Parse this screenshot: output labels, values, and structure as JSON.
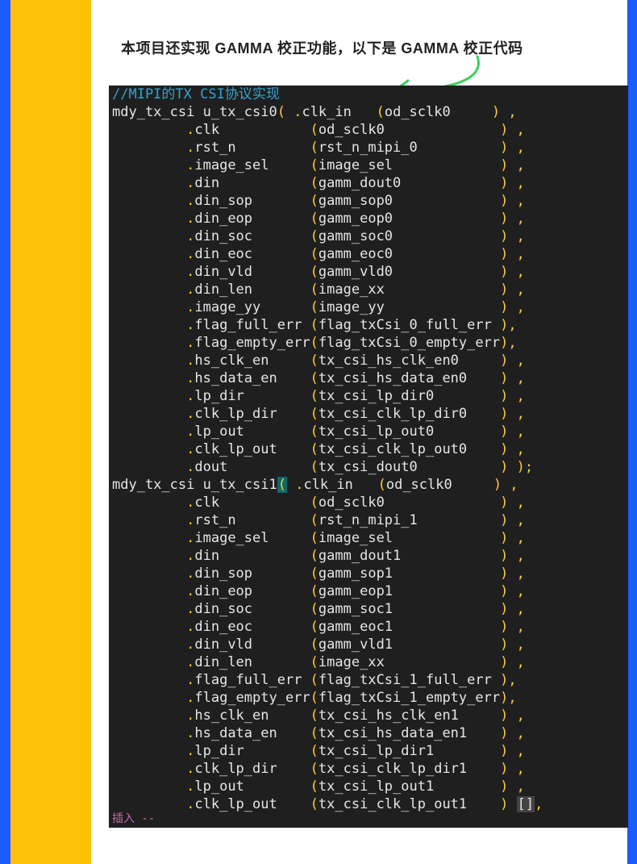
{
  "heading": "本项目还实现 GAMMA 校正功能，以下是 GAMMA 校正代码",
  "bottom_hint": "插入 --",
  "code": {
    "comment": "//MIPI的TX CSI协议实现",
    "inst0": {
      "module": "mdy_tx_csi",
      "name": "u_tx_csi0",
      "first_port": "clk_in",
      "first_sig": "od_sclk0",
      "ports": [
        {
          "p": "clk",
          "s": "od_sclk0"
        },
        {
          "p": "rst_n",
          "s": "rst_n_mipi_0"
        },
        {
          "p": "image_sel",
          "s": "image_sel"
        },
        {
          "p": "din",
          "s": "gamm_dout0"
        },
        {
          "p": "din_sop",
          "s": "gamm_sop0"
        },
        {
          "p": "din_eop",
          "s": "gamm_eop0"
        },
        {
          "p": "din_soc",
          "s": "gamm_soc0"
        },
        {
          "p": "din_eoc",
          "s": "gamm_eoc0"
        },
        {
          "p": "din_vld",
          "s": "gamm_vld0"
        },
        {
          "p": "din_len",
          "s": "image_xx"
        },
        {
          "p": "image_yy",
          "s": "image_yy"
        },
        {
          "p": "flag_full_err",
          "s": "flag_txCsi_0_full_err",
          "nosp": true
        },
        {
          "p": "flag_empty_err",
          "s": "flag_txCsi_0_empty_err",
          "nosp": true
        },
        {
          "p": "hs_clk_en",
          "s": "tx_csi_hs_clk_en0"
        },
        {
          "p": "hs_data_en",
          "s": "tx_csi_hs_data_en0"
        },
        {
          "p": "lp_dir",
          "s": "tx_csi_lp_dir0"
        },
        {
          "p": "clk_lp_dir",
          "s": "tx_csi_clk_lp_dir0"
        },
        {
          "p": "lp_out",
          "s": "tx_csi_lp_out0"
        },
        {
          "p": "clk_lp_out",
          "s": "tx_csi_clk_lp_out0"
        },
        {
          "p": "dout",
          "s": "tx_csi_dout0",
          "last": true
        }
      ]
    },
    "inst1": {
      "module": "mdy_tx_csi",
      "name": "u_tx_csi1",
      "first_port": "clk_in",
      "first_sig": "od_sclk0",
      "ports": [
        {
          "p": "clk",
          "s": "od_sclk0"
        },
        {
          "p": "rst_n",
          "s": "rst_n_mipi_1"
        },
        {
          "p": "image_sel",
          "s": "image_sel"
        },
        {
          "p": "din",
          "s": "gamm_dout1"
        },
        {
          "p": "din_sop",
          "s": "gamm_sop1"
        },
        {
          "p": "din_eop",
          "s": "gamm_eop1"
        },
        {
          "p": "din_soc",
          "s": "gamm_soc1"
        },
        {
          "p": "din_eoc",
          "s": "gamm_eoc1"
        },
        {
          "p": "din_vld",
          "s": "gamm_vld1"
        },
        {
          "p": "din_len",
          "s": "image_xx"
        },
        {
          "p": "flag_full_err",
          "s": "flag_txCsi_1_full_err",
          "nosp": true
        },
        {
          "p": "flag_empty_err",
          "s": "flag_txCsi_1_empty_err",
          "nosp": true
        },
        {
          "p": "hs_clk_en",
          "s": "tx_csi_hs_clk_en1"
        },
        {
          "p": "hs_data_en",
          "s": "tx_csi_hs_data_en1"
        },
        {
          "p": "lp_dir",
          "s": "tx_csi_lp_dir1"
        },
        {
          "p": "clk_lp_dir",
          "s": "tx_csi_clk_lp_dir1"
        },
        {
          "p": "lp_out",
          "s": "tx_csi_lp_out1"
        },
        {
          "p": "clk_lp_out",
          "s": "tx_csi_clk_lp_out1",
          "cursor": true
        }
      ]
    }
  }
}
